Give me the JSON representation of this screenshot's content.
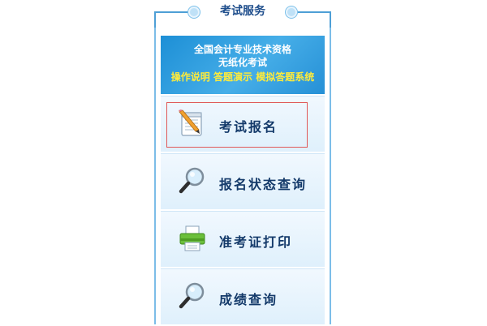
{
  "header": {
    "title": "考试服务"
  },
  "banner": {
    "line1": "全国会计专业技术资格",
    "line2": "无纸化考试",
    "links": [
      "操作说明",
      "答题演示",
      "模拟答题系统"
    ]
  },
  "menu": {
    "items": [
      {
        "label": "考试报名",
        "icon": "notepad-pencil-icon"
      },
      {
        "label": "报名状态查询",
        "icon": "magnifier-icon"
      },
      {
        "label": "准考证打印",
        "icon": "printer-icon"
      },
      {
        "label": "成绩查询",
        "icon": "magnifier-icon"
      }
    ]
  },
  "colors": {
    "accent": "#4e9fd6",
    "banner": "#2a98dc",
    "link_yellow": "#ffeb3b",
    "label": "#143a6a",
    "highlight_border": "#e05858"
  }
}
